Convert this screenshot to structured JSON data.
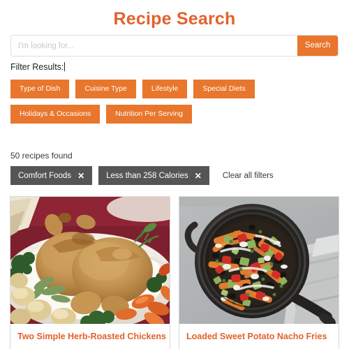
{
  "header": {
    "title": "Recipe Search"
  },
  "search": {
    "placeholder": "I'm looking for...",
    "value": "",
    "button_label": "Search"
  },
  "filters": {
    "label": "Filter Results:",
    "categories": [
      {
        "label": "Type of Dish"
      },
      {
        "label": "Cuisine Type"
      },
      {
        "label": "Lifestyle"
      },
      {
        "label": "Special Diets"
      },
      {
        "label": "Holidays & Occasions"
      },
      {
        "label": "Nutrition Per Serving"
      }
    ]
  },
  "results": {
    "count_text": "50 recipes found",
    "applied_chips": [
      {
        "label": "Comfort Foods",
        "remove_icon": "✕"
      },
      {
        "label": "Less than 258 Calories",
        "remove_icon": "✕"
      }
    ],
    "clear_all_label": "Clear all filters",
    "cards": [
      {
        "title": "Two Simple Herb-Roasted Chickens",
        "image_name": "roasted-chickens-photo"
      },
      {
        "title": "Loaded Sweet Potato Nacho Fries",
        "image_name": "sweet-potato-nacho-fries-photo"
      }
    ]
  },
  "colors": {
    "accent_orange": "#e8762c",
    "title_orange": "#e2622c",
    "chip_gray": "#555555",
    "border_gray": "#d8d8d8"
  }
}
